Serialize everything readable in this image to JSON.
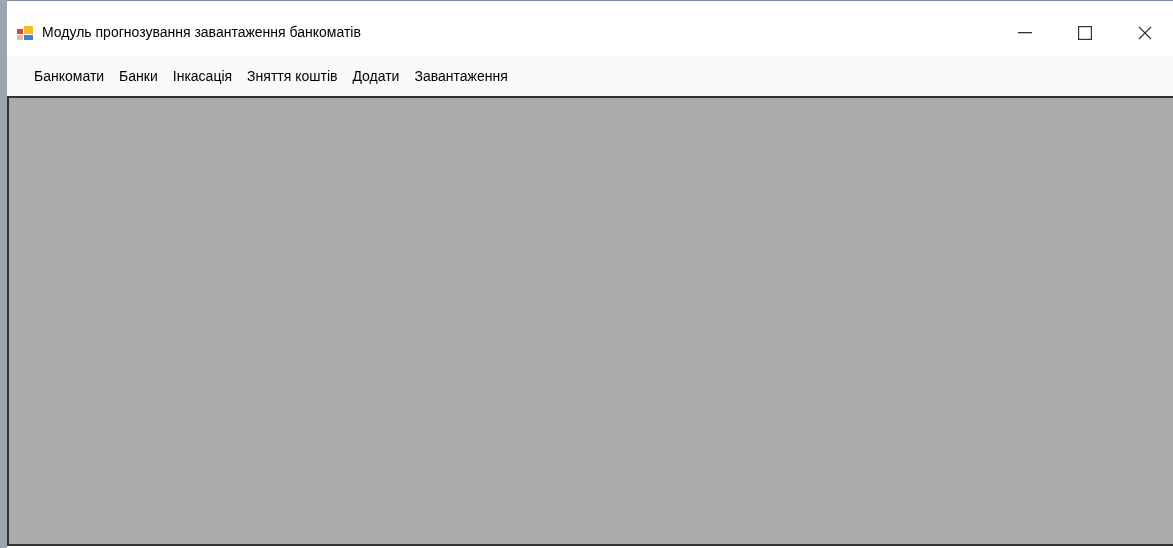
{
  "window": {
    "title": "Модуль прогнозування завантаження банкоматів"
  },
  "menu": [
    {
      "label": "Банкомати"
    },
    {
      "label": "Банки"
    },
    {
      "label": "Інкасація"
    },
    {
      "label": "Зняття коштів"
    },
    {
      "label": "Додати"
    },
    {
      "label": "Завантаження"
    }
  ]
}
